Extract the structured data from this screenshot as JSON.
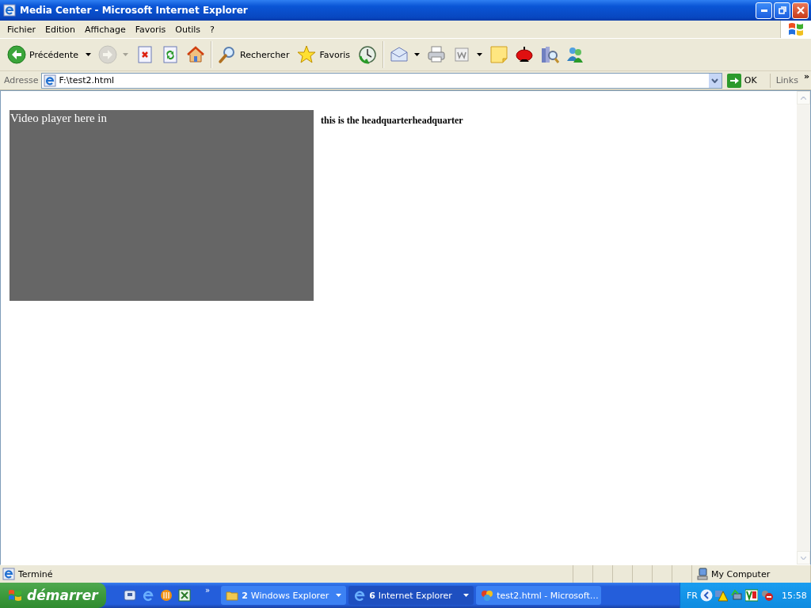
{
  "window": {
    "title": "Media Center - Microsoft Internet Explorer"
  },
  "menu": [
    "Fichier",
    "Edition",
    "Affichage",
    "Favoris",
    "Outils",
    "?"
  ],
  "toolbar": [
    {
      "kind": "back",
      "label": "Précédente",
      "dropdown": true,
      "disabled": false
    },
    {
      "kind": "forward",
      "dropdown": true,
      "disabled": true
    },
    {
      "kind": "stop",
      "dropdown": false,
      "disabled": false
    },
    {
      "kind": "refresh",
      "dropdown": false,
      "disabled": false
    },
    {
      "kind": "home",
      "dropdown": false,
      "disabled": false
    },
    {
      "kind": "search",
      "label": "Rechercher",
      "dropdown": false,
      "disabled": false
    },
    {
      "kind": "favorites",
      "label": "Favoris",
      "dropdown": false,
      "disabled": false
    },
    {
      "kind": "history",
      "dropdown": false,
      "disabled": false
    },
    {
      "kind": "mail",
      "dropdown": true,
      "disabled": false
    },
    {
      "kind": "print",
      "dropdown": false,
      "disabled": false
    },
    {
      "kind": "edit",
      "dropdown": true,
      "disabled": false
    },
    {
      "kind": "note",
      "dropdown": false,
      "disabled": false
    },
    {
      "kind": "bomb",
      "dropdown": false,
      "disabled": false
    },
    {
      "kind": "research",
      "dropdown": false,
      "disabled": false
    },
    {
      "kind": "messenger",
      "dropdown": false,
      "disabled": false
    }
  ],
  "address": {
    "label": "Adresse",
    "value": "F:\\test2.html",
    "go": "OK",
    "links": "Links",
    "more": "»"
  },
  "page": {
    "video_placeholder": "Video player here in",
    "heading": "this is the headquarterheadquarter"
  },
  "status_bar": {
    "text": "Terminé",
    "zone": "My Computer"
  },
  "taskbar": {
    "start": "démarrer",
    "more": "»",
    "tasks": [
      {
        "kind": "folder",
        "count": "2",
        "label": "Windows Explorer",
        "grouped": true,
        "selected": false
      },
      {
        "kind": "ie",
        "count": "6",
        "label": "Internet Explorer",
        "grouped": true,
        "selected": true
      },
      {
        "kind": "app",
        "label": "test2.html - Microsoft…",
        "grouped": false,
        "selected": false
      }
    ],
    "tray": {
      "language": "FR",
      "clock": "15:58"
    }
  }
}
